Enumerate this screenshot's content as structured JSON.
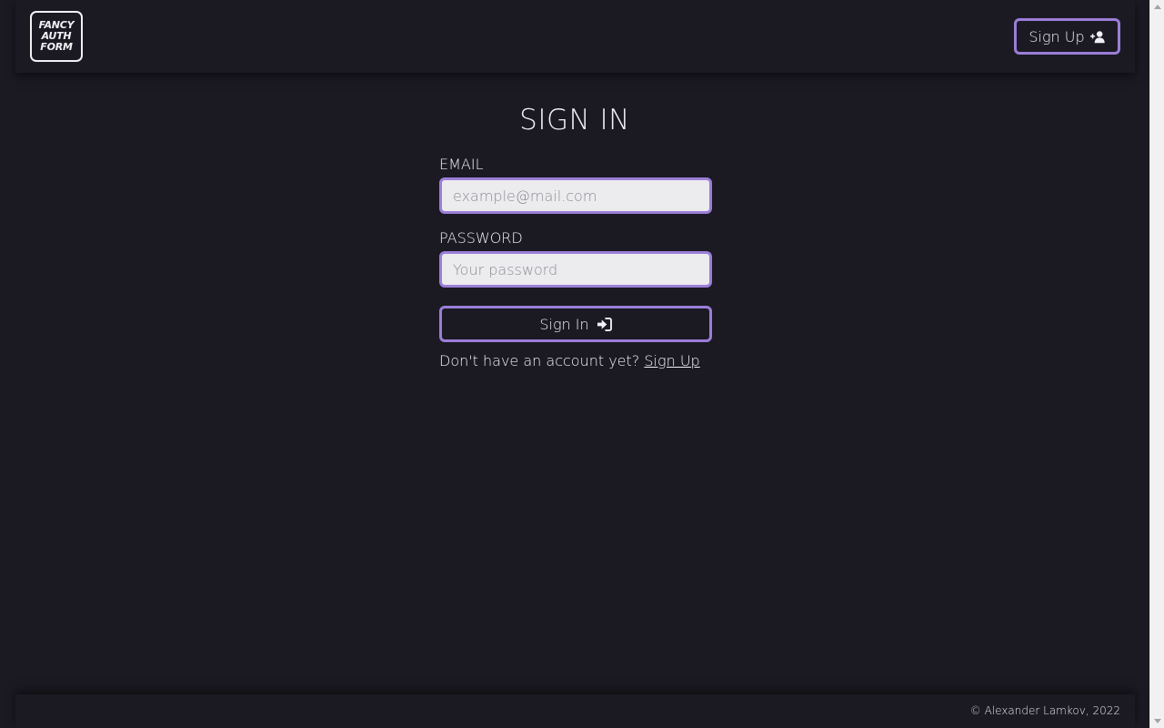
{
  "header": {
    "logo_lines": [
      "FANCY",
      "AUTH",
      "FORM"
    ],
    "signup_label": "Sign Up",
    "signup_icon": "user-plus-icon"
  },
  "main": {
    "title": "SIGN IN",
    "email": {
      "label": "EMAIL",
      "value": "",
      "placeholder": "example@mail.com"
    },
    "password": {
      "label": "PASSWORD",
      "value": "",
      "placeholder": "Your password"
    },
    "submit_label": "Sign In",
    "submit_icon": "sign-in-icon",
    "prompt_text": "Don't have an account yet?",
    "prompt_link": "Sign Up"
  },
  "footer": {
    "copyright": "© Alexander Lamkov, 2022"
  },
  "colors": {
    "background": "#1b1a23",
    "accent": "#9a7ed8",
    "text": "#f1f0f4",
    "input_background": "#ecebee"
  }
}
